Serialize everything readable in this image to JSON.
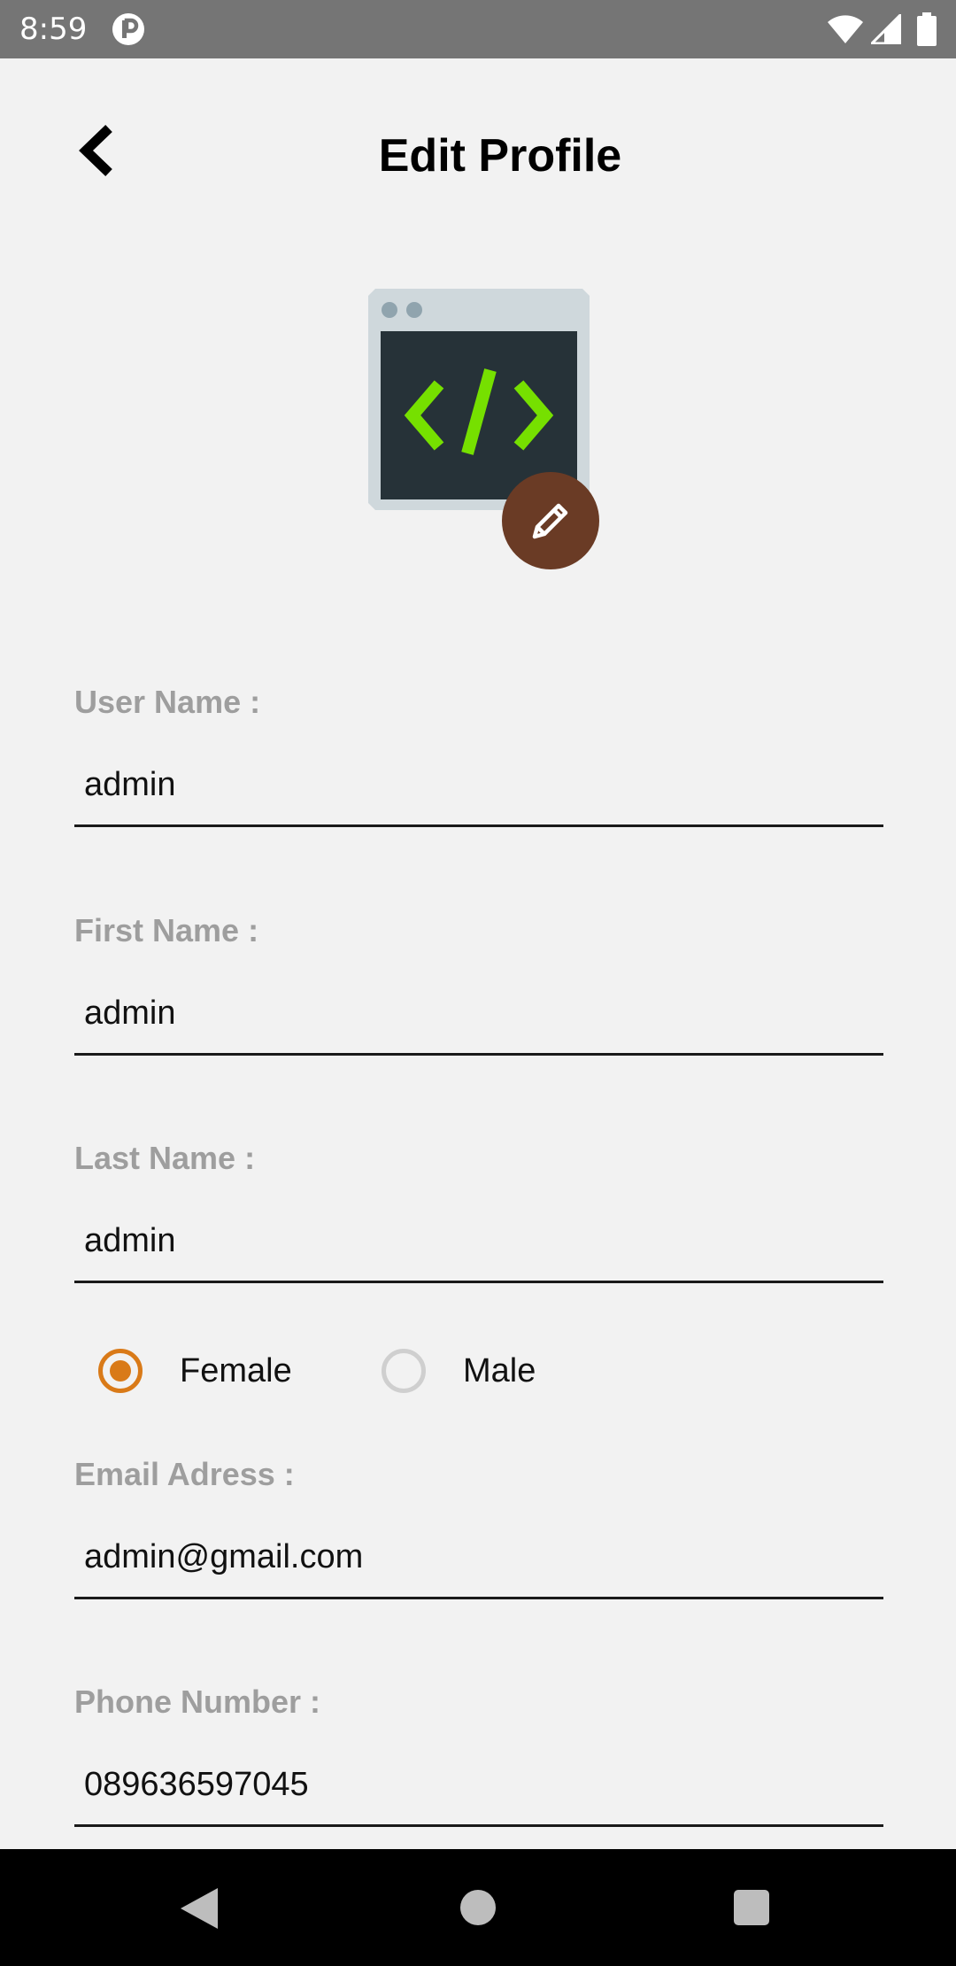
{
  "status_bar": {
    "time": "8:59",
    "icons": [
      "notification-app-icon",
      "wifi-icon",
      "signal-icon",
      "battery-icon"
    ]
  },
  "header": {
    "title": "Edit Profile",
    "back_icon": "chevron-left-icon"
  },
  "avatar": {
    "icon": "code-window-icon",
    "edit_icon": "pencil-icon",
    "colors": {
      "edit_button": "#6a3b25",
      "code_glyph": "#76e000",
      "window_frame": "#cfd8dc",
      "window_screen": "#263238"
    }
  },
  "form": {
    "username": {
      "label": "User Name :",
      "value": "admin"
    },
    "first_name": {
      "label": "First Name :",
      "value": "admin"
    },
    "last_name": {
      "label": "Last Name :",
      "value": "admin"
    },
    "gender": {
      "options": [
        {
          "label": "Female",
          "selected": true
        },
        {
          "label": "Male",
          "selected": false
        }
      ]
    },
    "email": {
      "label": "Email Adress :",
      "value": "admin@gmail.com"
    },
    "phone": {
      "label": "Phone Number :",
      "value": "089636597045"
    }
  },
  "colors": {
    "accent": "#d97a18",
    "label": "#9e9e9e",
    "background": "#f2f2f2"
  },
  "nav_bar": {
    "icons": [
      "nav-back-icon",
      "nav-home-icon",
      "nav-recents-icon"
    ]
  }
}
